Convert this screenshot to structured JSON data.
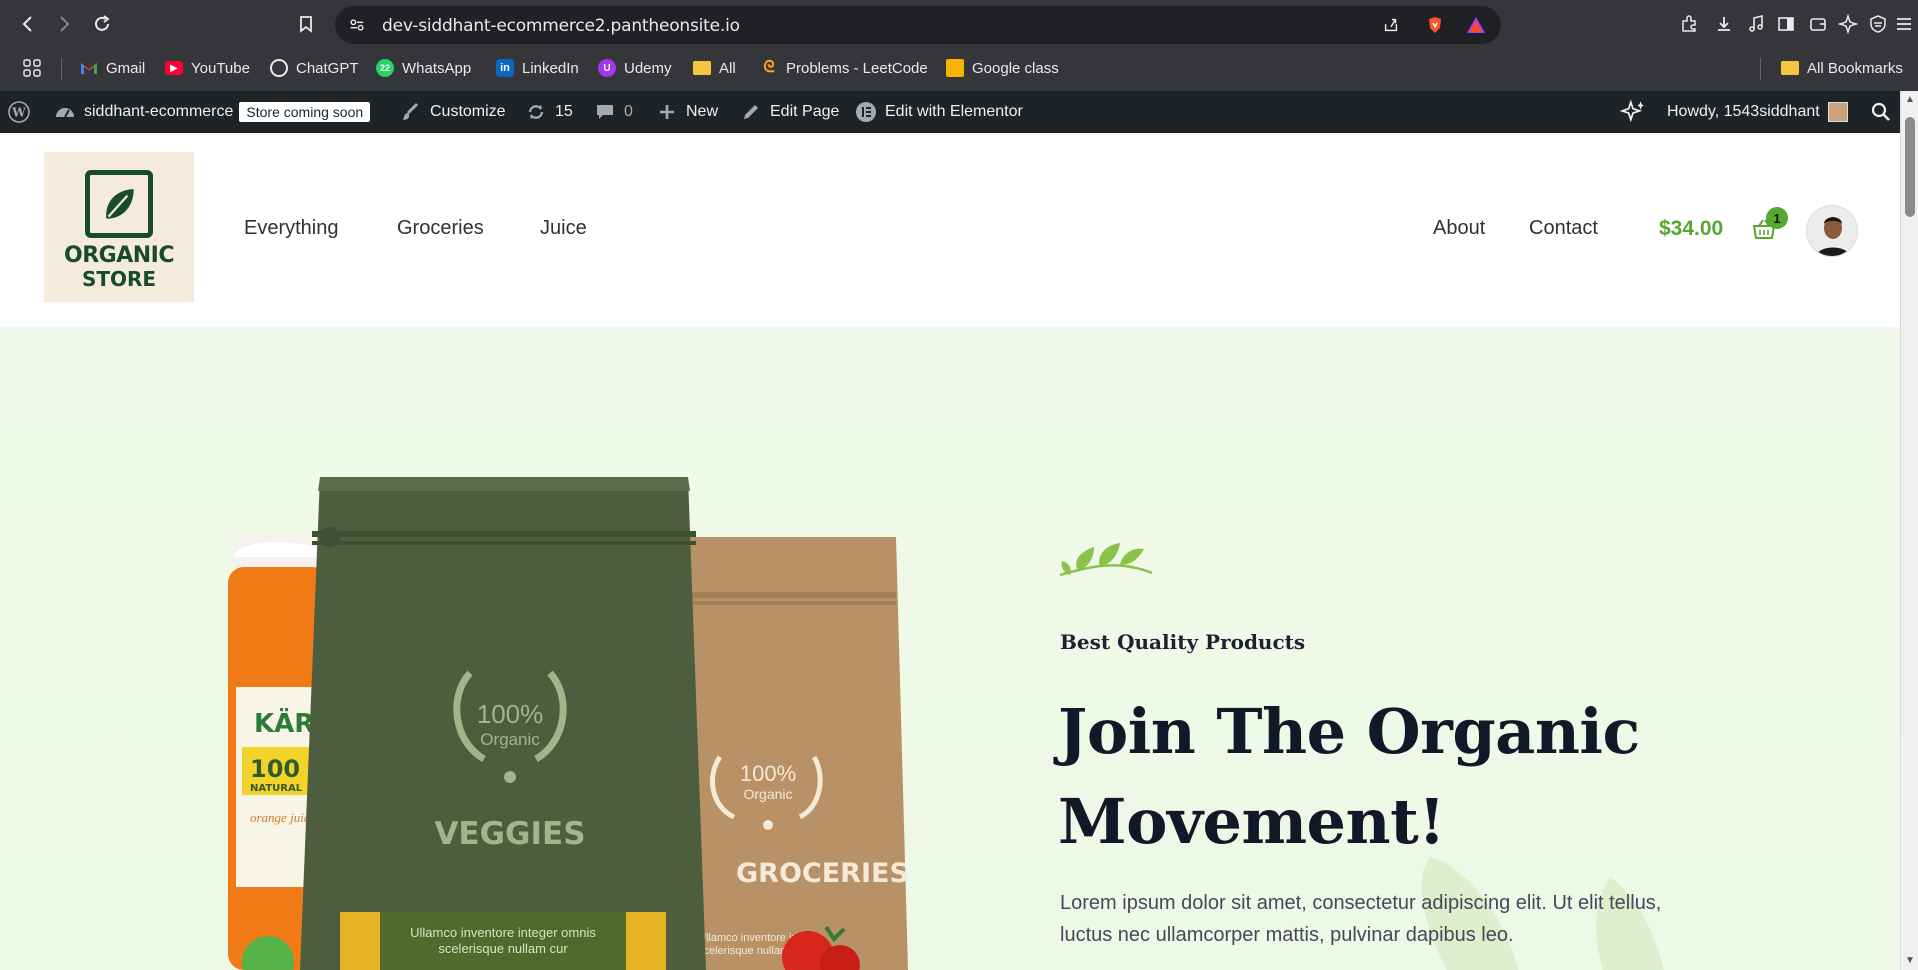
{
  "browser": {
    "url": "dev-siddhant-ecommerce2.pantheonsite.io",
    "bookmarks": [
      {
        "label": "Gmail",
        "icon": "gmail-icon"
      },
      {
        "label": "YouTube",
        "icon": "youtube-icon"
      },
      {
        "label": "ChatGPT",
        "icon": "chatgpt-icon"
      },
      {
        "label": "WhatsApp",
        "icon": "whatsapp-icon"
      },
      {
        "label": "LinkedIn",
        "icon": "linkedin-icon"
      },
      {
        "label": "Udemy",
        "icon": "udemy-icon"
      },
      {
        "label": "All",
        "icon": "folder-icon"
      },
      {
        "label": "Problems - LeetCode",
        "icon": "leetcode-icon"
      },
      {
        "label": "Google class",
        "icon": "google-classroom-icon"
      }
    ],
    "all_bookmarks": "All Bookmarks",
    "whatsapp_badge": "22"
  },
  "adminbar": {
    "site_name": "siddhant-ecommerce",
    "store_badge": "Store coming soon",
    "customize": "Customize",
    "updates_count": "15",
    "comments_count": "0",
    "new": "New",
    "edit_page": "Edit Page",
    "edit_elementor": "Edit with Elementor",
    "howdy": "Howdy, 1543siddhant"
  },
  "header": {
    "logo_line1": "ORGANIC",
    "logo_line2": "STORE",
    "menu_left": [
      "Everything",
      "Groceries",
      "Juice"
    ],
    "menu_right": [
      "About",
      "Contact"
    ],
    "cart_amount": "$34.00",
    "cart_count": "1"
  },
  "hero": {
    "eyebrow": "Best Quality Products",
    "headline": "Join The Organic Movement!",
    "lead": "Lorem ipsum dolor sit amet, consectetur adipiscing elit. Ut elit tellus, luctus nec ullamcorper mattis, pulvinar dapibus leo.",
    "products": {
      "bag1_percent": "100%",
      "bag1_organic": "Organic",
      "bag1_name": "VEGGIES",
      "bag1_label": "Ullamco inventore integer omnis scelerisque nullam cur",
      "bag2_percent": "100%",
      "bag2_organic": "Organic",
      "bag2_name": "GROCERIES",
      "bag2_label": "Ullamco inventore integer scelerisque nullam ut",
      "jar_brand": "KÄRT",
      "jar_percent": "100",
      "jar_natural": "NATURAL",
      "jar_text": "orange juice"
    },
    "colors": {
      "accent_green": "#57a82f",
      "bag_green": "#4d5e3e",
      "bag_kraft": "#b89166",
      "logo_green": "#184a2d"
    }
  }
}
